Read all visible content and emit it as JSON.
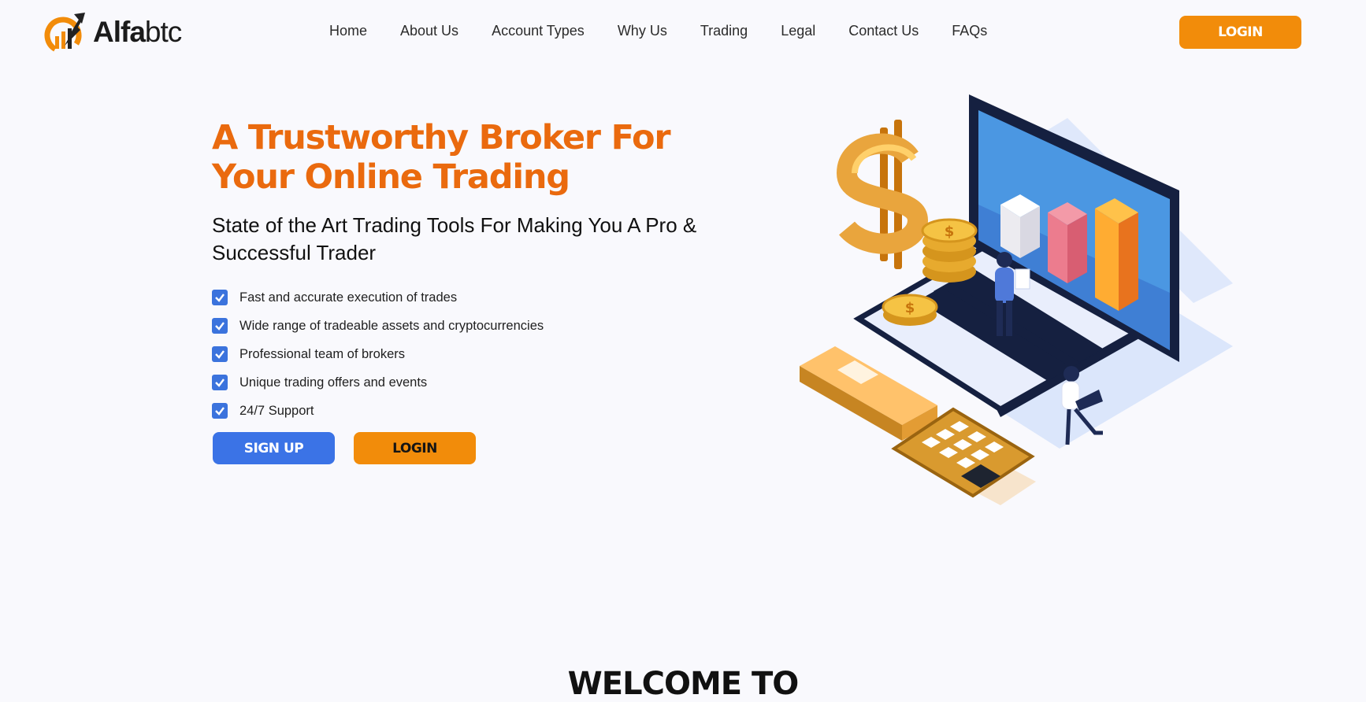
{
  "header": {
    "logo": {
      "bold": "Alfa",
      "light": "btc"
    },
    "nav": [
      "Home",
      "About Us",
      "Account Types",
      "Why Us",
      "Trading",
      "Legal",
      "Contact Us",
      "FAQs"
    ],
    "login_label": "LOGIN"
  },
  "hero": {
    "title_line1": "A Trustworthy Broker For",
    "title_line2": "Your Online Trading",
    "subtitle": "State of the Art Trading Tools For Making You A Pro & Successful Trader",
    "features": [
      "Fast and accurate execution of trades",
      "Wide range of tradeable assets and cryptocurrencies",
      "Professional team of brokers",
      "Unique trading offers and events",
      "24/7 Support"
    ],
    "signup_label": "SIGN UP",
    "login_label": "LOGIN"
  },
  "welcome": {
    "heading": "WELCOME TO"
  },
  "colors": {
    "accent": "#ea6a0e",
    "login": "#f28c0a",
    "primary": "#3b73e6",
    "background": "#f9f9fd"
  }
}
